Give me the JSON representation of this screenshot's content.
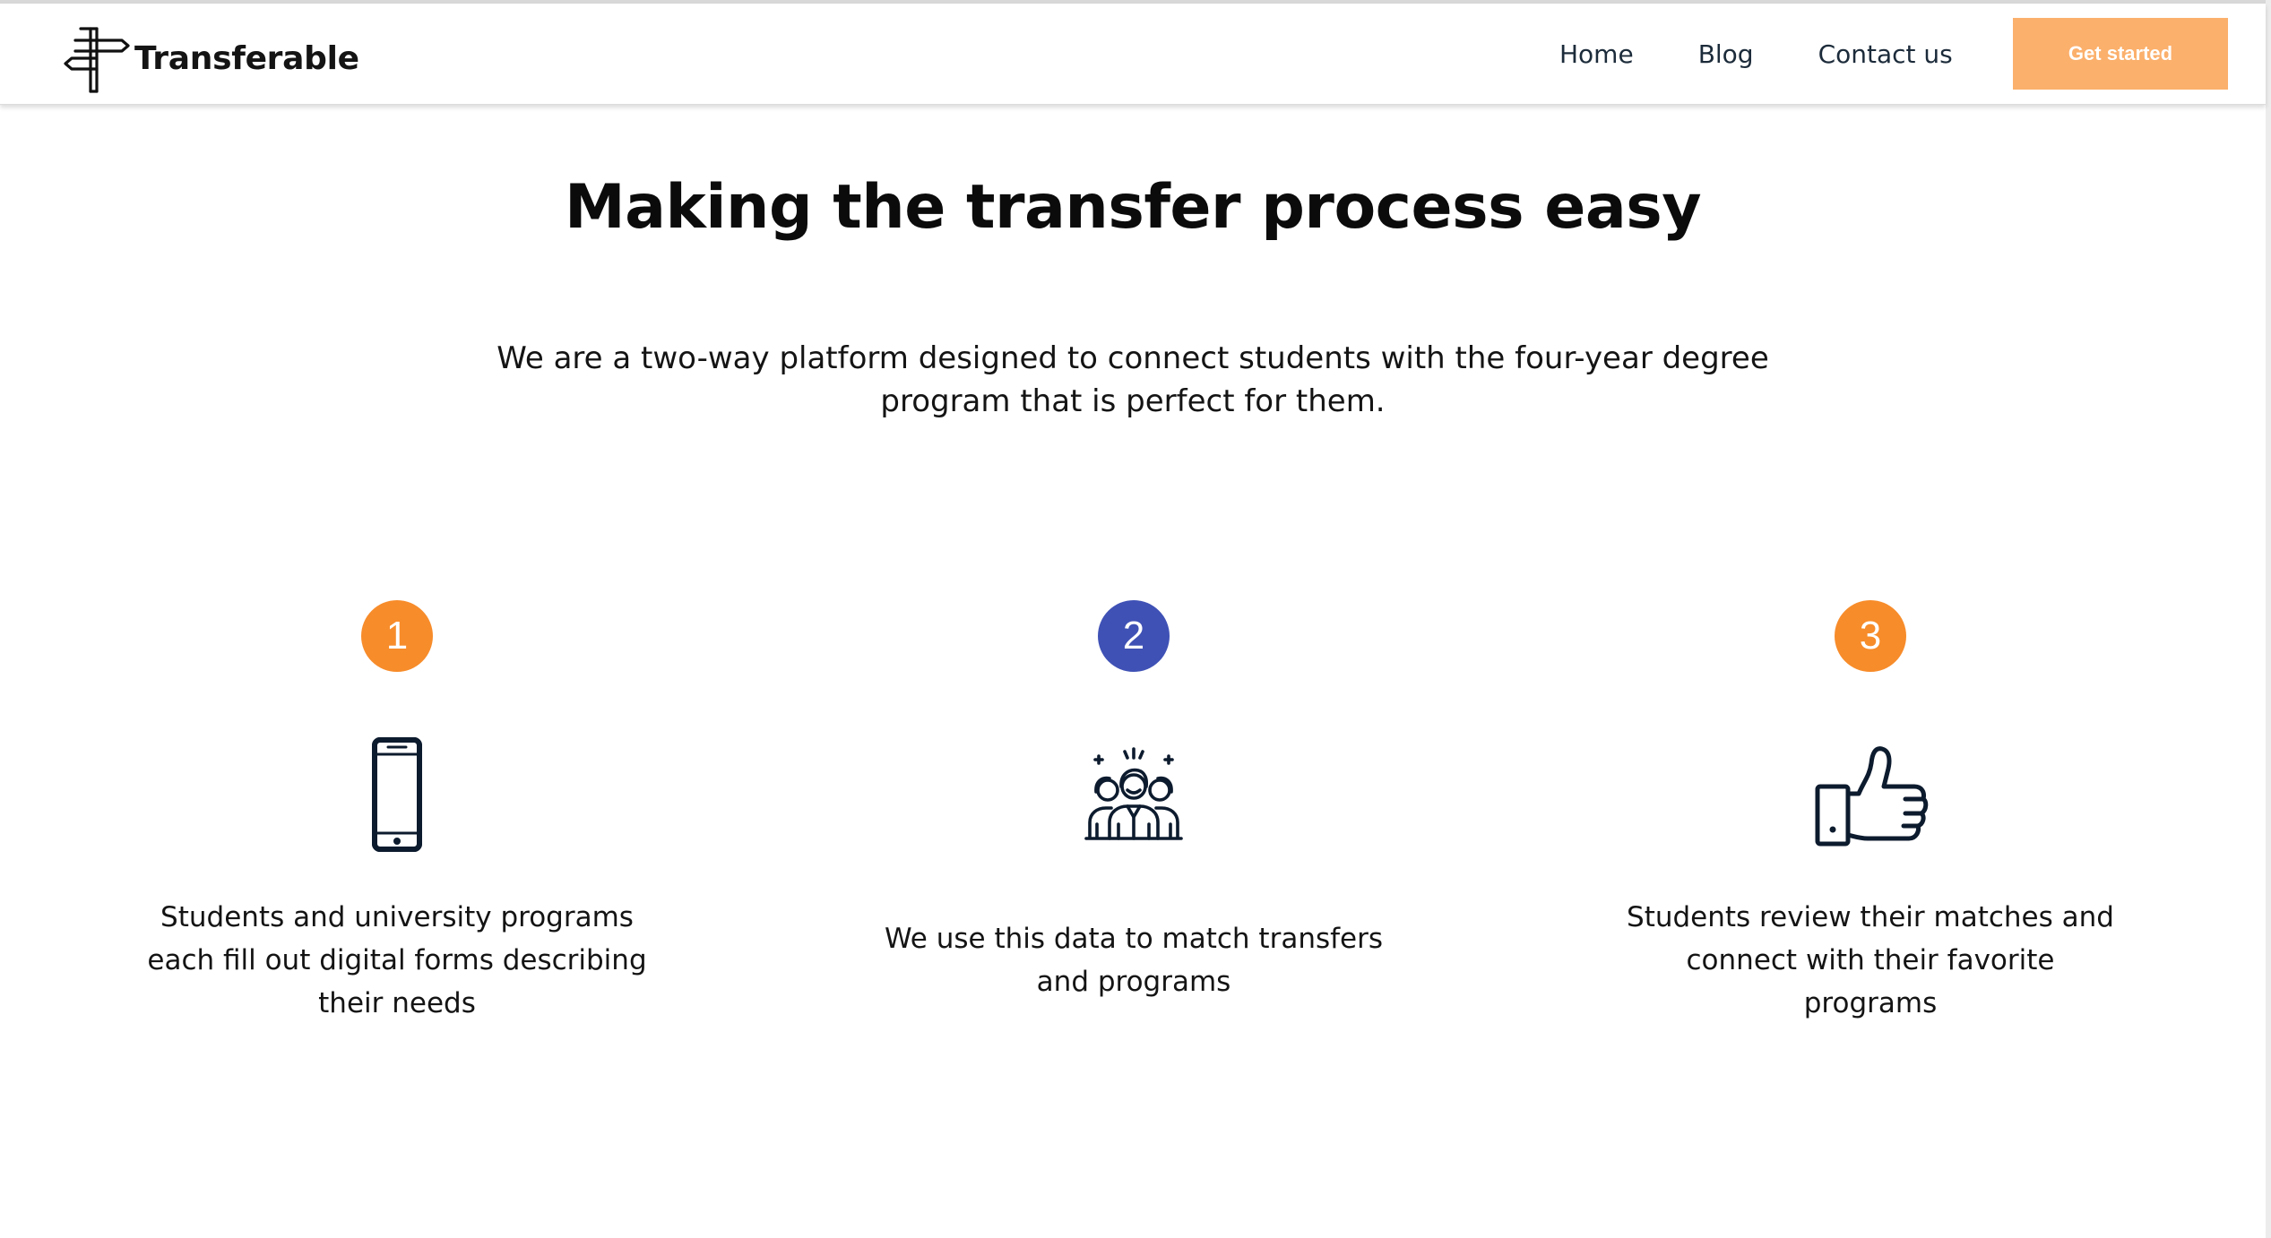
{
  "header": {
    "brand": "Transferable",
    "nav": [
      {
        "label": "Home"
      },
      {
        "label": "Blog"
      },
      {
        "label": "Contact us"
      }
    ],
    "cta_label": "Get started"
  },
  "hero": {
    "title": "Making the transfer process easy",
    "subtitle": "We are a two-way platform designed to connect students with the four-year degree program that is perfect for them."
  },
  "steps": [
    {
      "number": "1",
      "icon": "smartphone-icon",
      "color": "#f78c2a",
      "text": "Students and university programs each fill out digital forms describing their needs"
    },
    {
      "number": "2",
      "icon": "group-icon",
      "color": "#3f51b5",
      "text": "We use this data to match transfers and programs"
    },
    {
      "number": "3",
      "icon": "thumbs-up-icon",
      "color": "#f78c2a",
      "text": "Students review their matches and connect with their favorite programs"
    }
  ],
  "colors": {
    "accent_orange": "#f78c2a",
    "accent_blue": "#3f51b5",
    "cta_background": "#fbb06c",
    "icon_navy": "#0d1b2e",
    "text": "#141414"
  }
}
